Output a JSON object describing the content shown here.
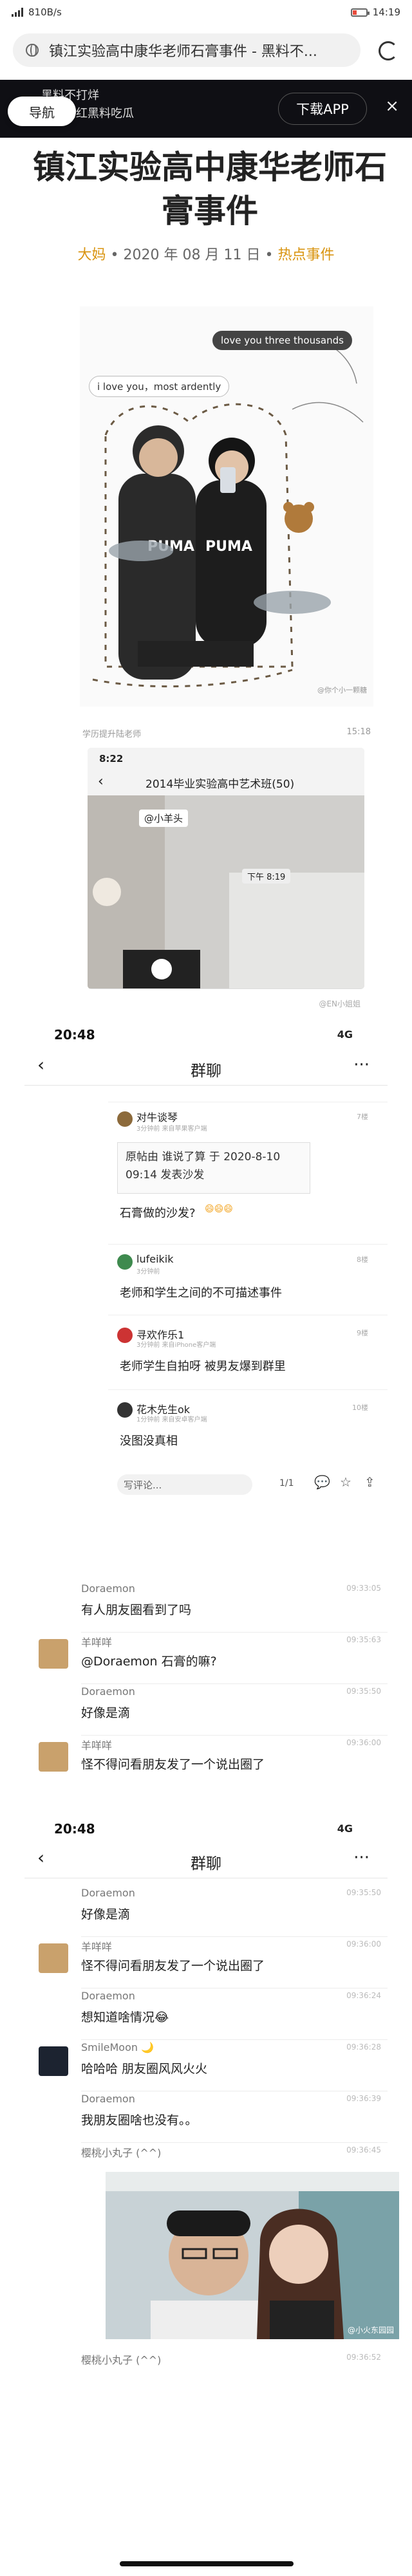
{
  "status_bar": {
    "net_speed": "810B/s",
    "time": "14:19"
  },
  "address_bar": {
    "url_title": "镇江实验高中康华老师石膏事件 - 黑料不..."
  },
  "ad_banner": {
    "nav_label": "导航",
    "line1": "黑料不打烊",
    "line2": "黑料网红黑料吃瓜",
    "download_label": "下载APP",
    "close": "×"
  },
  "article": {
    "title": "镇江实验高中康华老师石膏事件",
    "author": "大妈",
    "separator": "•",
    "date": "2020 年 08 月 11 日",
    "tag": "热点事件"
  },
  "photo1": {
    "bubble_top": "love you three thousands",
    "bubble_left": "i love you，most ardently",
    "watermark": "@你个小一颗糖"
  },
  "chat2": {
    "header_left": "学历提升陆老师",
    "header_right": "15:18",
    "phone_time": "8:22",
    "group_name": "2014毕业实验高中艺术班(50)",
    "mention": "@小羊头",
    "time_chip": "下午 8:19",
    "watermark": "@EN小姐姐"
  },
  "chat_screen_1": {
    "time": "20:48",
    "signal": "4G",
    "title": "群聊",
    "back": "‹",
    "more": "···",
    "comments": [
      {
        "user": "对牛谈琴",
        "sub": "3分钟前 来自苹果客户端",
        "floor": "7楼",
        "quote": "原帖由 谁说了算 于 2020-8-10 09:14 发表沙发",
        "text": "石膏做的沙发?"
      },
      {
        "user": "lufeikik",
        "sub": "3分钟前",
        "floor": "8楼",
        "text": "老师和学生之间的不可描述事件"
      },
      {
        "user": "寻欢作乐1",
        "sub": "3分钟前 来自iPhone客户端",
        "floor": "9楼",
        "text": "老师学生自拍呀 被男友爆到群里"
      },
      {
        "user": "花木先生ok",
        "sub": "1分钟前 来自安卓客户端",
        "floor": "10楼",
        "text": "没图没真相"
      }
    ],
    "reply_placeholder": "写评论...",
    "page": "1/1",
    "messages": [
      {
        "name": "Doraemon",
        "time": "09:33:05",
        "text": "有人朋友圈看到了吗"
      },
      {
        "name": "羊咩咩",
        "time": "09:35:63",
        "text": "@Doraemon 石膏的嘛?"
      },
      {
        "name": "Doraemon",
        "time": "09:35:50",
        "text": "好像是滴"
      },
      {
        "name": "羊咩咩",
        "time": "09:36:00",
        "text": "怪不得问看朋友发了一个说出圈了"
      }
    ]
  },
  "chat_screen_2": {
    "time": "20:48",
    "signal": "4G",
    "title": "群聊",
    "back": "‹",
    "more": "···",
    "messages": [
      {
        "name": "Doraemon",
        "time": "09:35:50",
        "text": "好像是滴"
      },
      {
        "name": "羊咩咩",
        "time": "09:36:00",
        "text": "怪不得问看朋友发了一个说出圈了"
      },
      {
        "name": "Doraemon",
        "time": "09:36:24",
        "text": "想知道啥情况😂"
      },
      {
        "name": "SmileMoon 🌙",
        "time": "09:36:28",
        "text": "哈哈哈 朋友圈风风火火"
      },
      {
        "name": "Doraemon",
        "time": "09:36:39",
        "text": "我朋友圈啥也没有。。"
      },
      {
        "name": "樱桃小丸子 (^^)",
        "time": "09:36:45",
        "text": ""
      }
    ],
    "last_name": "樱桃小丸子 (^^)",
    "last_time": "09:36:52",
    "photo_watermark": "@小火东园园"
  }
}
